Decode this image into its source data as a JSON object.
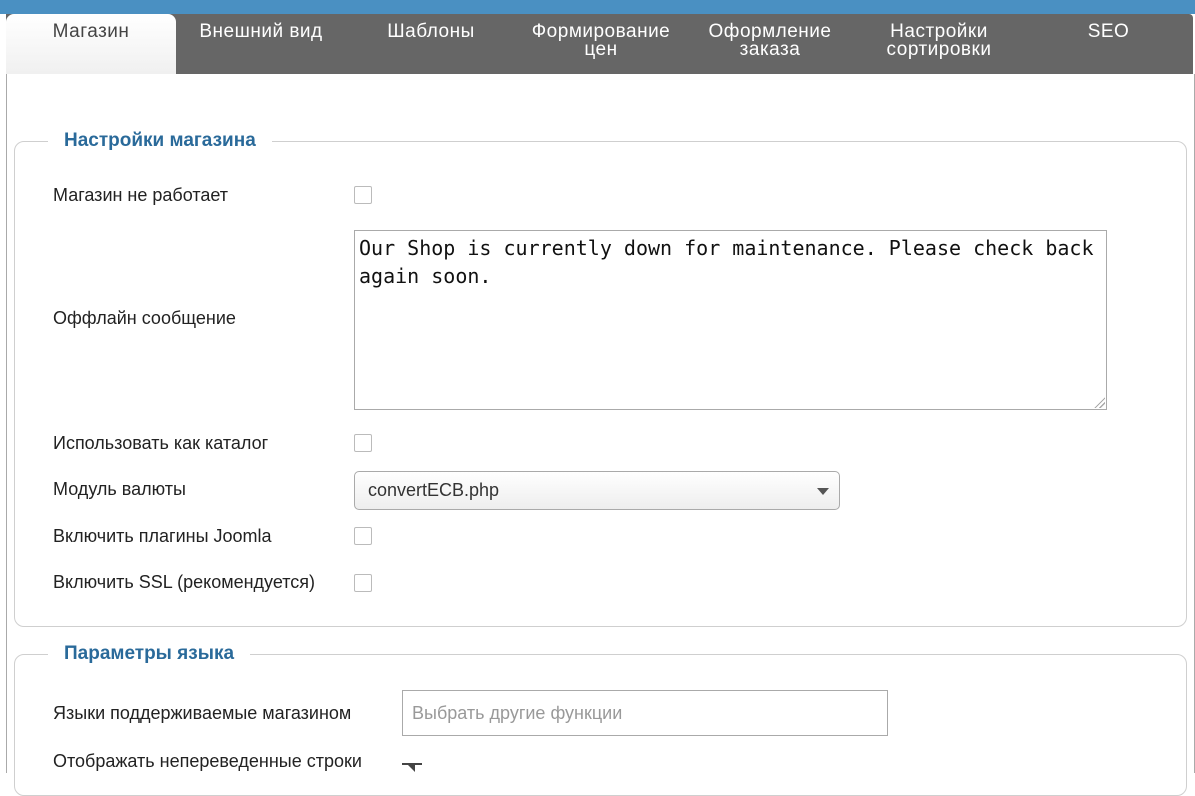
{
  "tabs": [
    {
      "label": "Магазин",
      "active": true
    },
    {
      "label": "Внешний вид",
      "active": false
    },
    {
      "label": "Шаблоны",
      "active": false
    },
    {
      "label": "Формирование\nцен",
      "active": false
    },
    {
      "label": "Оформление\nзаказа",
      "active": false
    },
    {
      "label": "Настройки\nсортировки",
      "active": false
    },
    {
      "label": "SEO",
      "active": false
    }
  ],
  "shop_settings": {
    "legend": "Настройки магазина",
    "shop_offline_label": "Магазин не работает",
    "shop_offline_checked": false,
    "offline_message_label": "Оффлайн сообщение",
    "offline_message_value": "Our Shop is currently down for maintenance. Please check back again soon.",
    "use_as_catalog_label": "Использовать как каталог",
    "use_as_catalog_checked": false,
    "currency_module_label": "Модуль валюты",
    "currency_module_value": "convertECB.php",
    "joomla_plugins_label": "Включить плагины Joomla",
    "joomla_plugins_checked": false,
    "ssl_label": "Включить SSL (рекомендуется)",
    "ssl_checked": false
  },
  "language_settings": {
    "legend": "Параметры языка",
    "languages_label": "Языки поддерживаемые магазином",
    "languages_placeholder": "Выбрать другие функции",
    "untranslated_label": "Отображать непереведенные строки"
  },
  "colors": {
    "topbar": "#4a90c2",
    "tab_bar": "#666666",
    "legend_text": "#2a6a9a"
  }
}
